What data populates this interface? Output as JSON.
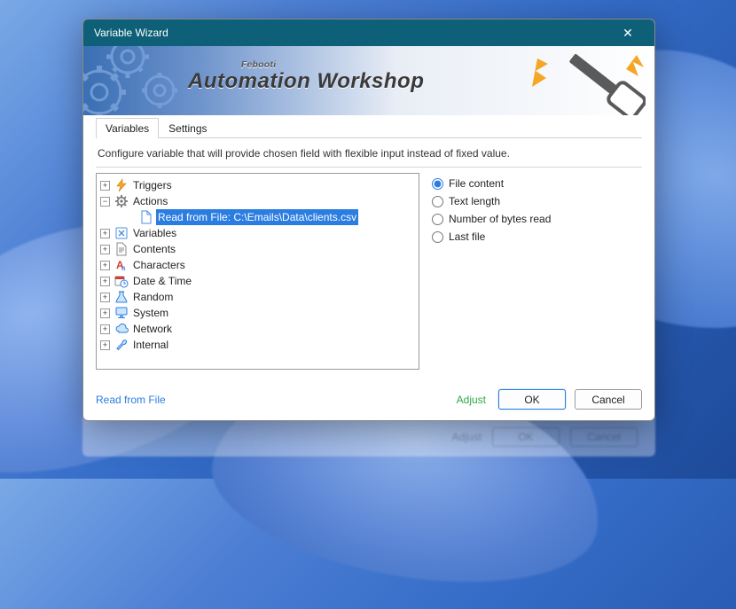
{
  "window": {
    "title": "Variable Wizard",
    "brand": "Automation Workshop",
    "brand_small": "Febooti"
  },
  "tabs": {
    "variables": "Variables",
    "settings": "Settings"
  },
  "desc": "Configure variable that will provide chosen field with flexible input instead of fixed value.",
  "tree": {
    "triggers": "Triggers",
    "actions": "Actions",
    "actions_child": "Read from File: C:\\Emails\\Data\\clients.csv",
    "variables": "Variables",
    "contents": "Contents",
    "characters": "Characters",
    "datetime": "Date & Time",
    "random": "Random",
    "system": "System",
    "network": "Network",
    "internal": "Internal"
  },
  "radios": {
    "file_content": "File content",
    "text_length": "Text length",
    "bytes_read": "Number of bytes read",
    "last_file": "Last file"
  },
  "footer": {
    "left": "Read from File",
    "adjust": "Adjust",
    "ok": "OK",
    "cancel": "Cancel"
  }
}
